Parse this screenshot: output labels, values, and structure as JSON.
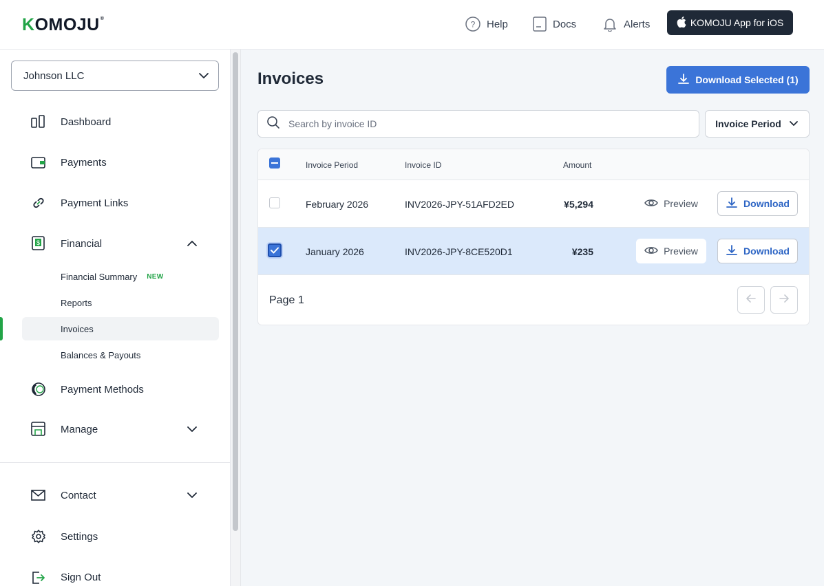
{
  "header": {
    "logo_text": "KOMOJU",
    "nav": [
      {
        "label": "Help",
        "icon": "help-circle-icon"
      },
      {
        "label": "Docs",
        "icon": "document-icon"
      },
      {
        "label": "Alerts",
        "icon": "bell-icon"
      }
    ],
    "ios_app_label": "KOMOJU App for iOS"
  },
  "sidebar": {
    "company_selector": "Johnson LLC",
    "items": [
      {
        "label": "Dashboard",
        "icon": "dashboard-icon"
      },
      {
        "label": "Payments",
        "icon": "wallet-icon"
      },
      {
        "label": "Payment Links",
        "icon": "link-icon"
      },
      {
        "label": "Financial",
        "icon": "financial-icon",
        "expanded": true
      },
      {
        "label": "Payment Methods",
        "icon": "payment-methods-icon"
      },
      {
        "label": "Manage",
        "icon": "manage-icon",
        "expanded": false
      }
    ],
    "financial_sub": [
      {
        "label": "Financial Summary",
        "badge": "NEW"
      },
      {
        "label": "Reports"
      },
      {
        "label": "Invoices",
        "active": true
      },
      {
        "label": "Balances & Payouts"
      }
    ],
    "bottom_items": [
      {
        "label": "Contact",
        "icon": "mail-icon"
      },
      {
        "label": "Settings",
        "icon": "gear-icon"
      },
      {
        "label": "Sign Out",
        "icon": "sign-out-icon"
      }
    ]
  },
  "main": {
    "title": "Invoices",
    "download_selected_label": "Download Selected (1)",
    "search_placeholder": "Search by invoice ID",
    "period_filter_label": "Invoice Period",
    "table": {
      "columns": [
        "Invoice Period",
        "Invoice ID",
        "Amount"
      ],
      "rows": [
        {
          "period": "February 2026",
          "invoice_id": "INV2026-JPY-51AFD2ED",
          "amount": "¥5,294",
          "selected": false
        },
        {
          "period": "January 2026",
          "invoice_id": "INV2026-JPY-8CE520D1",
          "amount": "¥235",
          "selected": true
        }
      ],
      "preview_label": "Preview",
      "download_label": "Download"
    },
    "pagination": {
      "label": "Page 1"
    }
  },
  "colors": {
    "brand_green": "#22a447",
    "primary_blue": "#3b74d8",
    "selected_row": "#dbe9fb",
    "dark_button": "#1f2937"
  }
}
